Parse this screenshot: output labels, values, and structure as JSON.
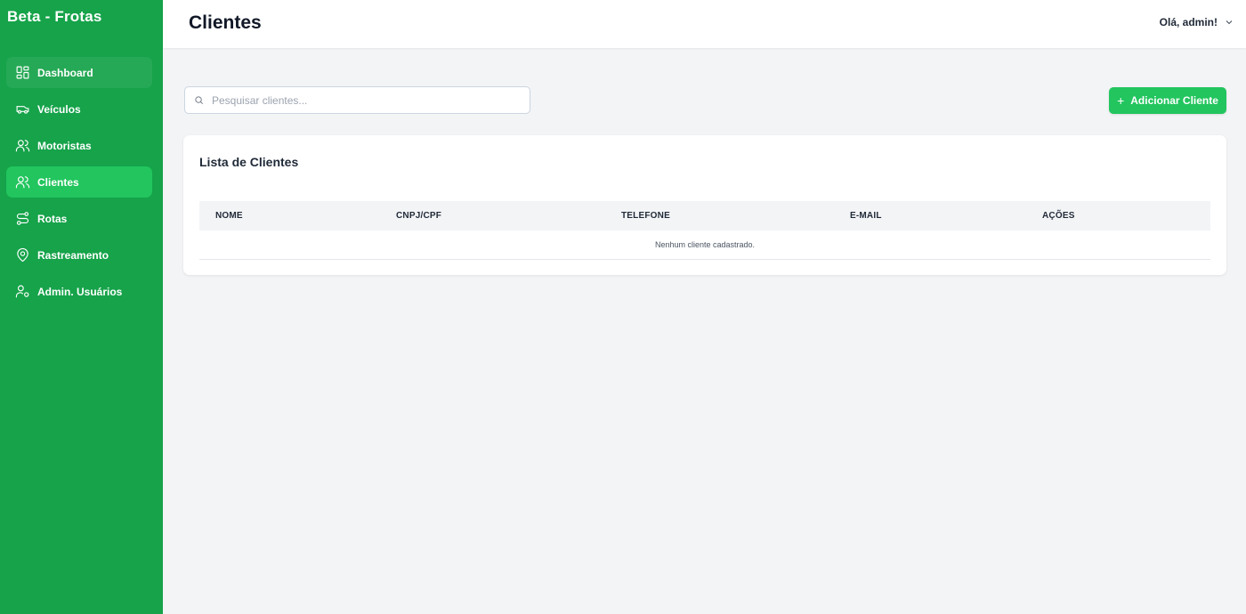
{
  "app": {
    "brand": "Beta - Frotas"
  },
  "sidebar": {
    "items": [
      {
        "label": "Dashboard",
        "icon": "dashboard-icon"
      },
      {
        "label": "Veículos",
        "icon": "truck-icon"
      },
      {
        "label": "Motoristas",
        "icon": "users-icon"
      },
      {
        "label": "Clientes",
        "icon": "users-icon",
        "active": true
      },
      {
        "label": "Rotas",
        "icon": "route-icon"
      },
      {
        "label": "Rastreamento",
        "icon": "map-pin-icon"
      },
      {
        "label": "Admin. Usuários",
        "icon": "user-cog-icon"
      }
    ]
  },
  "header": {
    "title": "Clientes",
    "user_greeting": "Olá, admin!"
  },
  "search": {
    "placeholder": "Pesquisar clientes...",
    "value": ""
  },
  "toolbar": {
    "add_label": "Adicionar Cliente"
  },
  "list": {
    "title": "Lista de Clientes",
    "columns": [
      "NOME",
      "CNPJ/CPF",
      "TELEFONE",
      "E-MAIL",
      "AÇÕES"
    ],
    "empty_message": "Nenhum cliente cadastrado."
  },
  "colors": {
    "sidebar_bg": "#16a34a",
    "accent": "#22c55e",
    "page_bg": "#f3f4f6"
  }
}
